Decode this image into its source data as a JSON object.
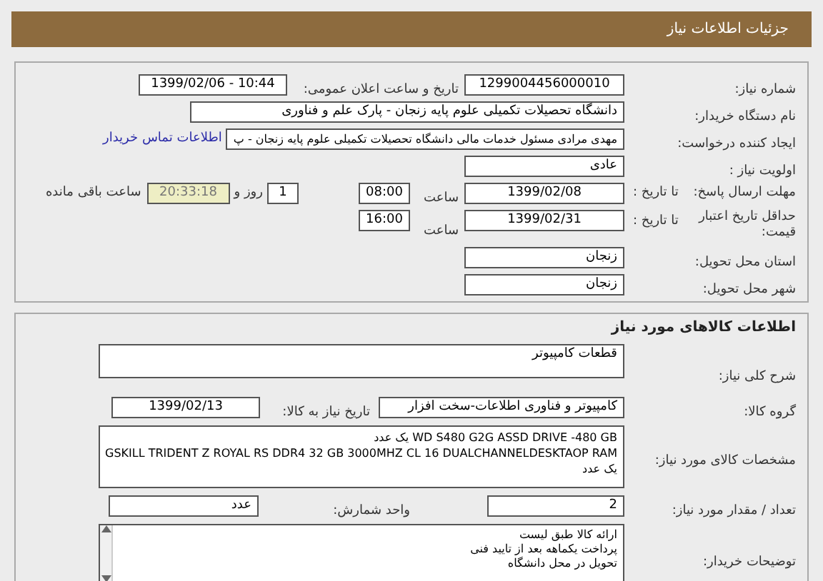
{
  "header": {
    "title": "جزئیات اطلاعات نیاز"
  },
  "need_info": {
    "need_number": {
      "label": "شماره نیاز:",
      "value": "1299004456000010"
    },
    "announce_date": {
      "label": "تاریخ و ساعت اعلان عمومی:",
      "value": "1399/02/06 - 10:44"
    },
    "buyer_org": {
      "label": "نام دستگاه خریدار:",
      "value": "دانشگاه تحصیلات تکمیلی علوم پایه زنجان - پارک علم و فناوری"
    },
    "requester": {
      "label": "ایجاد کننده درخواست:",
      "value": "مهدی مرادی مسئول خدمات مالی دانشگاه تحصیلات تکمیلی علوم پایه زنجان - پ",
      "link": "اطلاعات تماس خریدار"
    },
    "priority": {
      "label": "اولویت نیاز :",
      "value": "عادی"
    },
    "response_deadline": {
      "label": "مهلت ارسال پاسخ:",
      "to_date_label": "تا تاریخ :",
      "date": "1399/02/08",
      "time_label": "ساعت",
      "time": "08:00",
      "days": "1",
      "days_label": "روز و",
      "remaining": "20:33:18",
      "remaining_label": "ساعت باقی مانده"
    },
    "price_validity": {
      "label": "حداقل تاریخ اعتبار قیمت:",
      "to_date_label": "تا تاریخ :",
      "date": "1399/02/31",
      "time_label": "ساعت",
      "time": "16:00"
    },
    "province": {
      "label": "استان محل تحویل:",
      "value": "زنجان"
    },
    "city": {
      "label": "شهر محل تحویل:",
      "value": "زنجان"
    }
  },
  "goods": {
    "title": "اطلاعات کالاهای مورد نیاز",
    "summary": {
      "label": "شرح کلی نیاز:",
      "value": "قطعات کامپیوتر"
    },
    "group": {
      "label": "گروه کالا:",
      "value": "کامپیوتر و فناوری اطلاعات-سخت افزار"
    },
    "need_date": {
      "label": "تاریخ نیاز به کالا:",
      "value": "1399/02/13"
    },
    "specs": {
      "label": "مشخصات کالای مورد نیاز:",
      "lines": [
        "WD S480 G2G ASSD DRIVE -480 GB یک عدد",
        "GSKILL TRIDENT Z ROYAL RS DDR4 32 GB 3000MHZ CL 16 DUALCHANNELDESKTAOP RAM",
        "یک عدد"
      ]
    },
    "quantity": {
      "label": "تعداد / مقدار مورد نیاز:",
      "value": "2"
    },
    "unit": {
      "label": "واحد شمارش:",
      "value": "عدد"
    },
    "buyer_notes": {
      "label": "توضیحات خریدار:",
      "lines": [
        "ارائه کالا طبق لیست",
        "پرداخت یکماهه بعد از تایید فنی",
        "تحویل در محل دانشگاه"
      ]
    }
  }
}
